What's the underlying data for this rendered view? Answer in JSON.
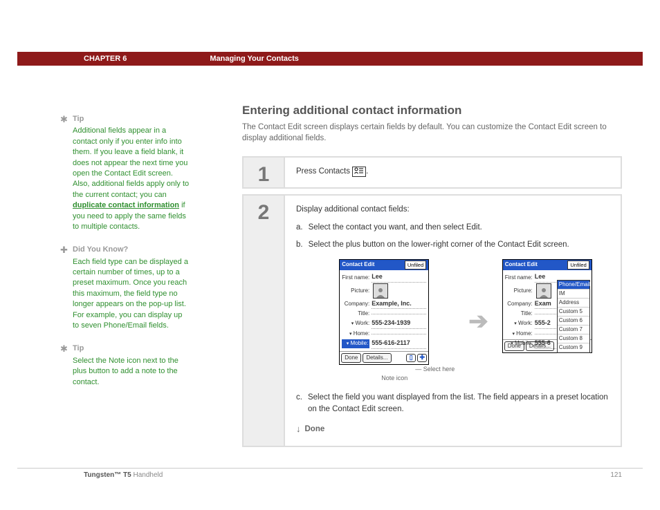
{
  "header": {
    "chapter": "CHAPTER 6",
    "title": "Managing Your Contacts"
  },
  "sidebar": {
    "tip1": {
      "label": "Tip",
      "text_before": "Additional fields appear in a contact only if you enter info into them. If you leave a field blank, it does not appear the next time you open the Contact Edit screen. Also, additional fields apply only to the current contact; you can ",
      "link": "duplicate contact information",
      "text_after": " if you need to apply the same fields to multiple contacts."
    },
    "dyk": {
      "label": "Did You Know?",
      "text": "Each field type can be displayed a certain number of times, up to a preset maximum. Once you reach this maximum, the field type no longer appears on the pop-up list. For example, you can display up to seven Phone/Email fields."
    },
    "tip2": {
      "label": "Tip",
      "text": "Select the Note icon next to the plus button to add a note to the contact."
    }
  },
  "main": {
    "heading": "Entering additional contact information",
    "intro": "The Contact Edit screen displays certain fields by default. You can customize the Contact Edit screen to display additional fields.",
    "step1": {
      "num": "1",
      "text": "Press Contacts "
    },
    "step2": {
      "num": "2",
      "lead": "Display additional contact fields:",
      "a": "Select the contact you want, and then select Edit.",
      "b": "Select the plus button on the lower-right corner of the Contact Edit screen.",
      "c": "Select the field you want displayed from the list. The field appears in a preset location on the Contact Edit screen.",
      "done": "Done",
      "callout_select": "Select here",
      "callout_note": "Note icon"
    }
  },
  "screenshots": {
    "s1": {
      "title": "Contact Edit",
      "category": "Unfiled",
      "first_name_lbl": "First name:",
      "first_name": "Lee",
      "picture_lbl": "Picture:",
      "company_lbl": "Company:",
      "company": "Example, Inc.",
      "title_lbl": "Title:",
      "work_lbl": "Work:",
      "work": "555-234-1939",
      "home_lbl": "Home:",
      "mobile_lbl": "Mobile:",
      "mobile": "555-616-2117",
      "btn_done": "Done",
      "btn_details": "Details..."
    },
    "s2": {
      "title": "Contact Edit",
      "category": "Unfiled",
      "first_name": "Lee",
      "company": "Exam",
      "work": "555-2",
      "mobile": "555-6",
      "popup": [
        "Phone/Email",
        "IM",
        "Address",
        "Custom 5",
        "Custom 6",
        "Custom 7",
        "Custom 8",
        "Custom 9"
      ]
    }
  },
  "footer": {
    "product_bold": "Tungsten™ T5",
    "product_rest": " Handheld",
    "page": "121"
  }
}
